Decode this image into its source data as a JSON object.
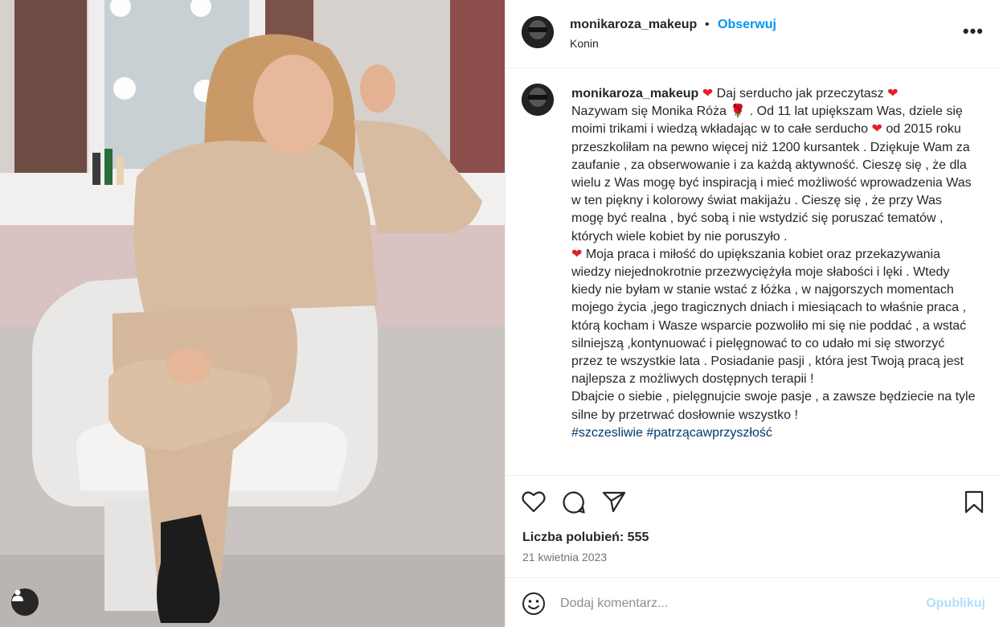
{
  "post": {
    "username": "monikaroza_makeup",
    "follow_label": "Obserwuj",
    "separator": "•",
    "location": "Konin",
    "more_icon": "more-options-icon",
    "caption": {
      "line1": " Daj serducho jak przeczytasz ",
      "body1": "Nazywam się Monika Róża 🌹 . Od 11 lat upiększam Was, dziele się moimi trikami i wiedzą wkładając w to całe serducho ",
      "body2": " od 2015 roku przeszkoliłam na pewno więcej niż 1200 kursantek . Dziękuje Wam za zaufanie , za obserwowanie i za każdą aktywność. Cieszę się , że dla wielu z Was mogę być inspiracją i mieć możliwość wprowadzenia Was w ten piękny i kolorowy świat makijażu . Cieszę się , że przy Was mogę być realna , być sobą i nie wstydzić się poruszać tematów , których wiele kobiet by nie poruszyło .",
      "body3": " Moja praca i miłość do upiększania kobiet oraz przekazywania wiedzy niejednokrotnie przezwyciężyła moje słabości i lęki . Wtedy kiedy nie byłam w stanie wstać z łóżka , w najgorszych momentach mojego życia ,jego tragicznych dniach i miesiącach to właśnie praca , którą kocham i Wasze wsparcie pozwoliło mi się nie poddać , a wstać silniejszą ,kontynuować i pielęgnować to co udało mi się stworzyć przez te wszystkie lata . Posiadanie pasji , która jest Twoją pracą jest najlepsza z możliwych dostępnych terapii !",
      "body4": "Dbajcie o siebie , pielęgnujcie swoje pasje , a zawsze będziecie na tyle silne by przetrwać dosłownie wszystko !",
      "hashtags": "#szczesliwie #patrzącawprzyszłość"
    },
    "heart_glyph": "❤",
    "likes_text": "Liczba polubień: 555",
    "date": "21 kwietnia 2023",
    "comment_placeholder": "Dodaj komentarz...",
    "publish_label": "Opublikuj",
    "icons": [
      "like-heart-icon",
      "comment-icon",
      "share-icon",
      "save-bookmark-icon",
      "emoji-icon",
      "tagged-user-icon"
    ]
  },
  "colors": {
    "follow_blue": "#0095f6",
    "publish_disabled": "#b2dffc",
    "hashtag": "#00376b",
    "heart_red": "#e0212c"
  }
}
